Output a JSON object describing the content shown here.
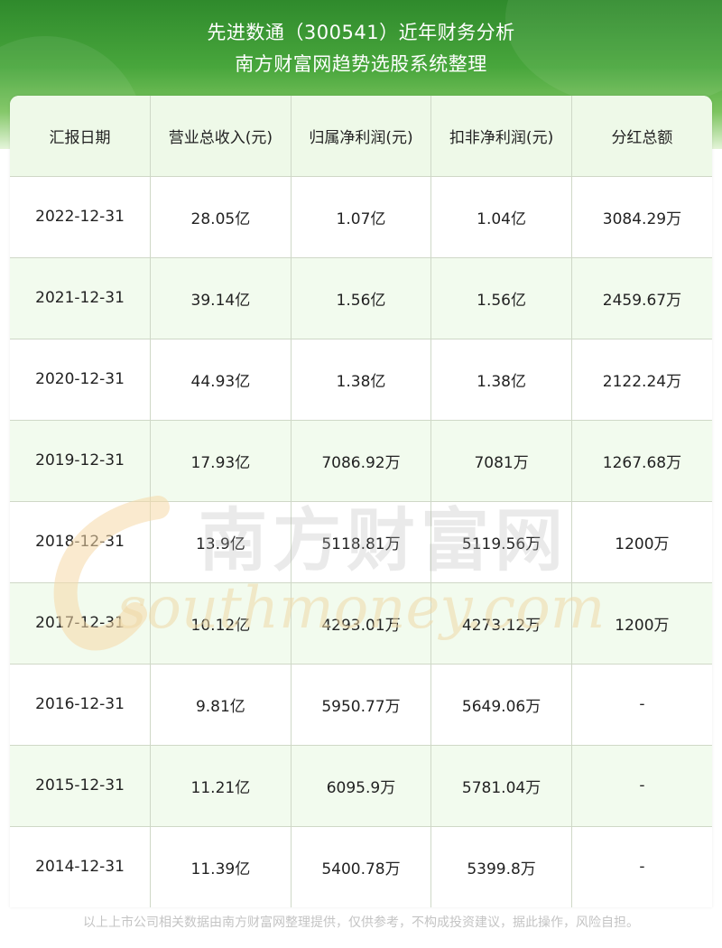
{
  "header": {
    "title_line1": "先进数通（300541）近年财务分析",
    "title_line2": "南方财富网趋势选股系统整理"
  },
  "table": {
    "columns": [
      "汇报日期",
      "营业总收入(元)",
      "归属净利润(元)",
      "扣非净利润(元)",
      "分红总额"
    ],
    "rows": [
      [
        "2022-12-31",
        "28.05亿",
        "1.07亿",
        "1.04亿",
        "3084.29万"
      ],
      [
        "2021-12-31",
        "39.14亿",
        "1.56亿",
        "1.56亿",
        "2459.67万"
      ],
      [
        "2020-12-31",
        "44.93亿",
        "1.38亿",
        "1.38亿",
        "2122.24万"
      ],
      [
        "2019-12-31",
        "17.93亿",
        "7086.92万",
        "7081万",
        "1267.68万"
      ],
      [
        "2018-12-31",
        "13.9亿",
        "5118.81万",
        "5119.56万",
        "1200万"
      ],
      [
        "2017-12-31",
        "10.12亿",
        "4293.01万",
        "4273.12万",
        "1200万"
      ],
      [
        "2016-12-31",
        "9.81亿",
        "5950.77万",
        "5649.06万",
        "-"
      ],
      [
        "2015-12-31",
        "11.21亿",
        "6095.9万",
        "5781.04万",
        "-"
      ],
      [
        "2014-12-31",
        "11.39亿",
        "5400.78万",
        "5399.8万",
        "-"
      ]
    ]
  },
  "watermark": {
    "cn": "南方财富网",
    "en": "southmoney.com"
  },
  "footer": {
    "disclaimer": "以上上市公司相关数据由南方财富网整理提供，仅供参考，不构成投资建议，据此操作，风险自担。"
  }
}
